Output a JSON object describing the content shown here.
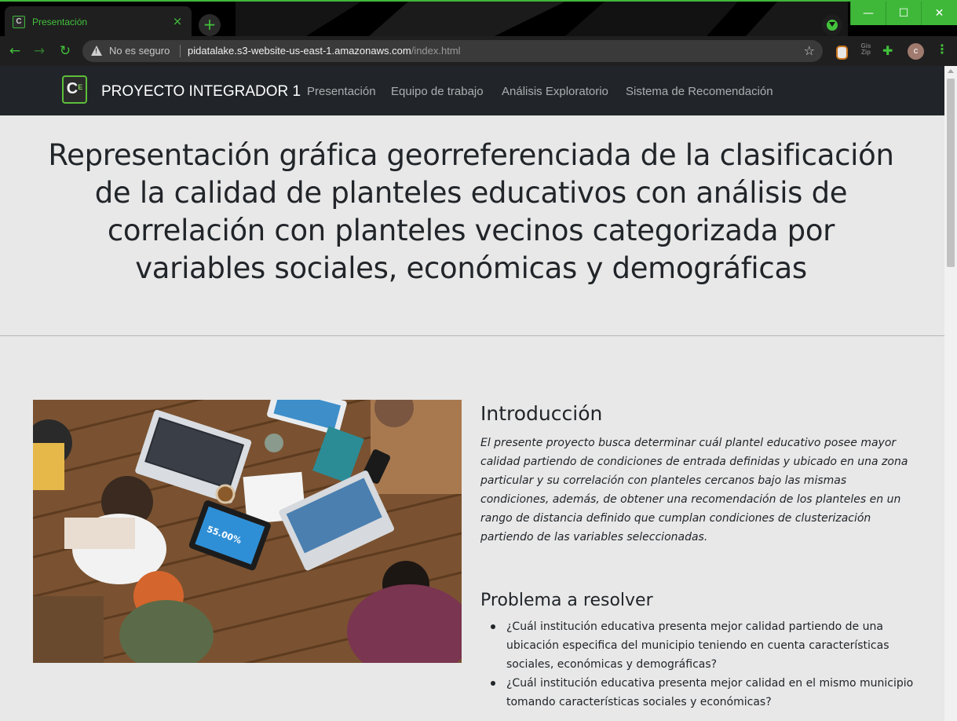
{
  "browser": {
    "tab_title": "Presentación",
    "tab_close": "×",
    "new_tab": "+",
    "security_label": "No es seguro",
    "url_host": "pidatalake.s3-website-us-east-1.amazonaws.com",
    "url_path": "/index.html",
    "profile_initial": "c",
    "window_controls": {
      "minimize": "—",
      "maximize": "☐",
      "close": "✕"
    },
    "ext_zip_label": "Gis Zip",
    "colors": {
      "accent": "#3fb83a",
      "chrome_bg": "#000000",
      "toolbar_bg": "#1f1f1f"
    }
  },
  "site": {
    "logo_text": "C",
    "logo_sup": "E",
    "brand": "PROYECTO INTEGRADOR 1",
    "nav_links": [
      "Presentación",
      "Equipo de trabajo",
      "Análisis Exploratorio",
      "Sistema de Recomendación"
    ],
    "title": "Representación gráfica georreferenciada de la clasificación de la calidad de planteles educativos con análisis de correlación con planteles vecinos categorizada por variables sociales, económicas y demográficas",
    "intro": {
      "heading": "Introducción",
      "text": "El presente proyecto busca determinar cuál plantel educativo posee mayor calidad partiendo de condiciones de entrada definidas y ubicado en una zona particular y su correlación con planteles cercanos bajo las mismas condiciones, además, de obtener una recomendación de los planteles en un rango de distancia definido que cumplan condiciones de clusterización partiendo de las variables seleccionadas."
    },
    "problem": {
      "heading": "Problema a resolver",
      "items": [
        "¿Cuál institución educativa presenta mejor calidad partiendo de una ubicación especifica del municipio teniendo en cuenta características sociales, económicas y demográficas?",
        "¿Cuál institución educativa presenta mejor calidad en el mismo municipio tomando características sociales y económicas?"
      ]
    },
    "photo": {
      "tablet_text": "55.00%"
    }
  }
}
